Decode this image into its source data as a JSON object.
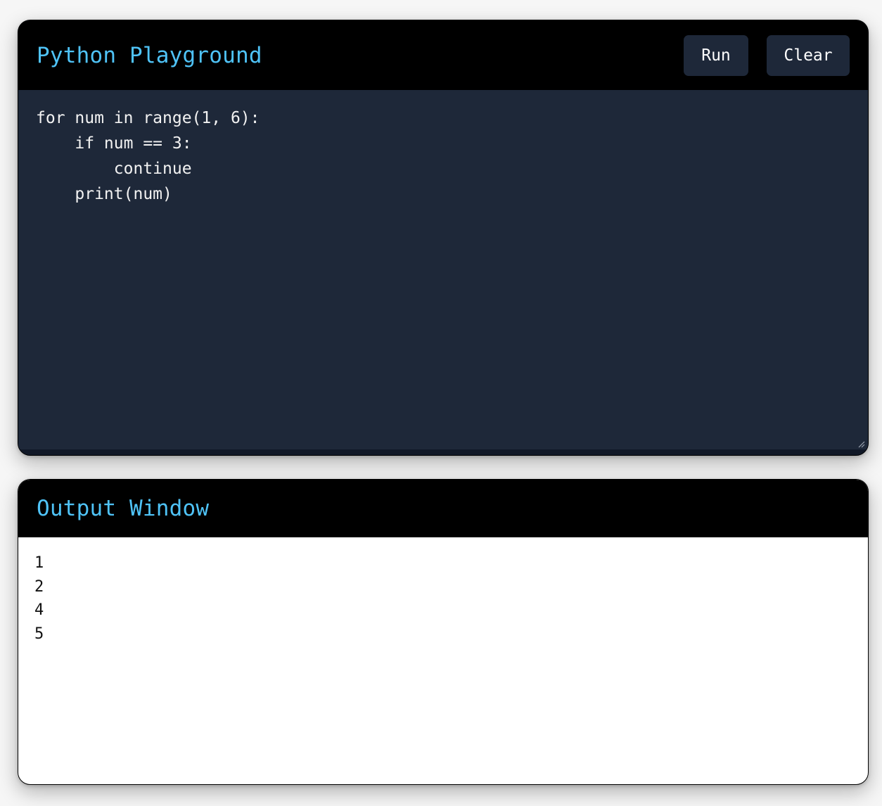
{
  "editor": {
    "title": "Python Playground",
    "run_label": "Run",
    "clear_label": "Clear",
    "code": "for num in range(1, 6):\n    if num == 3:\n        continue\n    print(num)"
  },
  "output": {
    "title": "Output Window",
    "lines": [
      "1",
      "2",
      "4",
      "5"
    ]
  },
  "colors": {
    "title_accent": "#4fc3f7",
    "header_bg": "#000000",
    "editor_bg": "#1e2839",
    "output_bg": "#ffffff"
  },
  "icons": {
    "resize": "resize-handle-icon"
  }
}
